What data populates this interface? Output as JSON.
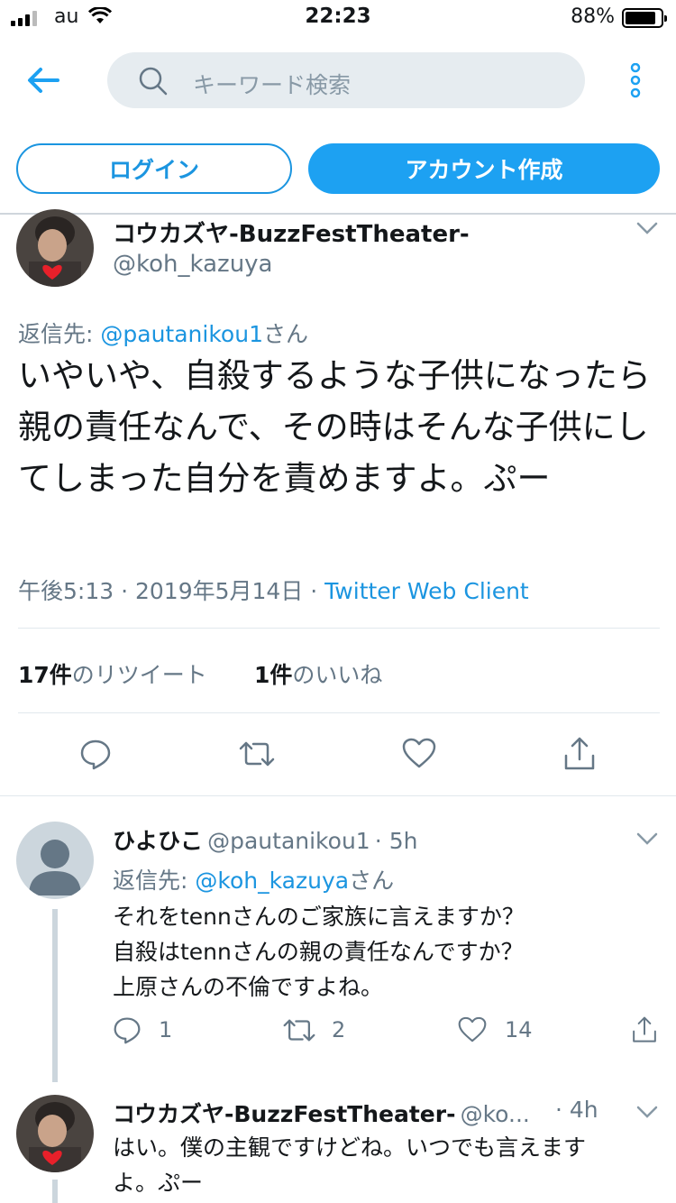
{
  "status_bar": {
    "carrier": "au",
    "time": "22:23",
    "battery": "88%"
  },
  "header": {
    "search_placeholder": "キーワード検索"
  },
  "buttons": {
    "login": "ログイン",
    "signup": "アカウント作成"
  },
  "main_tweet": {
    "name": "コウカズヤ-BuzzFestTheater-",
    "handle": "@koh_kazuya",
    "reply_prefix": "返信先:",
    "reply_to": "@pautanikou1",
    "reply_suffix": "さん",
    "text": "いやいや、自殺するような子供になったら親の責任なんで、その時はそんな子供にしてしまった自分を責めますよ。ぷー",
    "time": "午後5:13 · 2019年5月14日 ·",
    "client": "Twitter Web Client",
    "retweet_count": "17件",
    "retweet_label": "のリツイート",
    "like_count": "1件",
    "like_label": "のいいね"
  },
  "replies": [
    {
      "name": "ひよひこ",
      "handle": "@pautanikou1",
      "time": "· 5h",
      "reply_prefix": "返信先:",
      "reply_to": "@koh_kazuya",
      "reply_suffix": "さん",
      "lines": [
        "それをtennさんのご家族に言えますか？",
        "自殺はtennさんの親の責任なんですか？",
        "上原さんの不倫ですよね。"
      ],
      "reply_count": "1",
      "retweet_count": "2",
      "like_count": "14"
    },
    {
      "name": "コウカズヤ-BuzzFestTheater-",
      "handle": "@ko...",
      "time": "· 4h",
      "lines": [
        "はい。僕の主観ですけどね。いつでも言えます",
        "よ。ぷー"
      ]
    }
  ],
  "colors": {
    "accent": "#1da1f2",
    "link": "#1b95e0",
    "secondary": "#657786"
  },
  "icons": [
    "back-arrow-icon",
    "search-icon",
    "more-vertical-icon",
    "chevron-down-icon",
    "reply-icon",
    "retweet-icon",
    "like-icon",
    "share-icon"
  ]
}
